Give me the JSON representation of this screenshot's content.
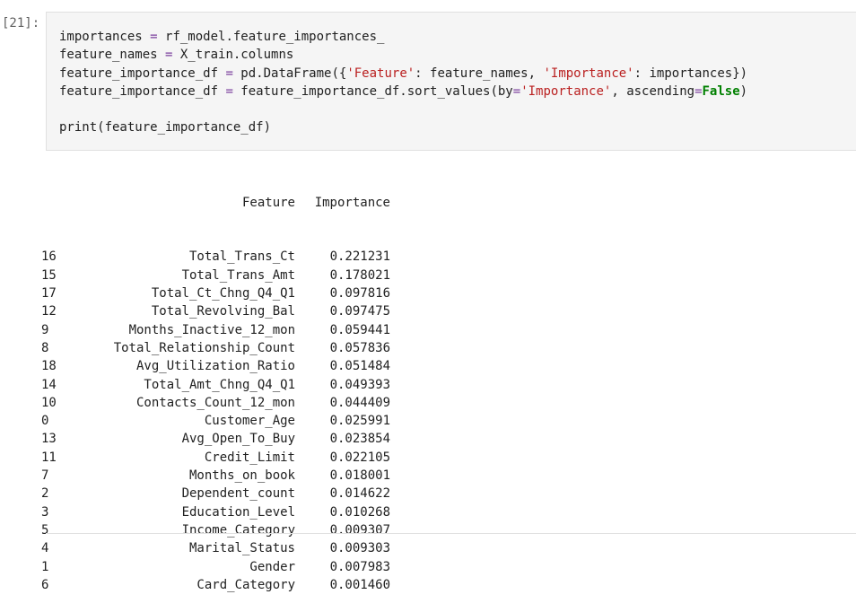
{
  "cell": {
    "prompt": "[21]:",
    "code_lines": [
      "importances = rf_model.feature_importances_",
      "feature_names = X_train.columns",
      "feature_importance_df = pd.DataFrame({'Feature': feature_names, 'Importance': importances})",
      "feature_importance_df = feature_importance_df.sort_values(by='Importance', ascending=False)",
      "",
      "print(feature_importance_df)"
    ]
  },
  "output": {
    "headers": [
      "Feature",
      "Importance"
    ],
    "rows": [
      {
        "index": "16",
        "feature": "Total_Trans_Ct",
        "importance": "0.221231"
      },
      {
        "index": "15",
        "feature": "Total_Trans_Amt",
        "importance": "0.178021"
      },
      {
        "index": "17",
        "feature": "Total_Ct_Chng_Q4_Q1",
        "importance": "0.097816"
      },
      {
        "index": "12",
        "feature": "Total_Revolving_Bal",
        "importance": "0.097475"
      },
      {
        "index": "9",
        "feature": "Months_Inactive_12_mon",
        "importance": "0.059441"
      },
      {
        "index": "8",
        "feature": "Total_Relationship_Count",
        "importance": "0.057836"
      },
      {
        "index": "18",
        "feature": "Avg_Utilization_Ratio",
        "importance": "0.051484"
      },
      {
        "index": "14",
        "feature": "Total_Amt_Chng_Q4_Q1",
        "importance": "0.049393"
      },
      {
        "index": "10",
        "feature": "Contacts_Count_12_mon",
        "importance": "0.044409"
      },
      {
        "index": "0",
        "feature": "Customer_Age",
        "importance": "0.025991"
      },
      {
        "index": "13",
        "feature": "Avg_Open_To_Buy",
        "importance": "0.023854"
      },
      {
        "index": "11",
        "feature": "Credit_Limit",
        "importance": "0.022105"
      },
      {
        "index": "7",
        "feature": "Months_on_book",
        "importance": "0.018001"
      },
      {
        "index": "2",
        "feature": "Dependent_count",
        "importance": "0.014622"
      },
      {
        "index": "3",
        "feature": "Education_Level",
        "importance": "0.010268"
      },
      {
        "index": "5",
        "feature": "Income_Category",
        "importance": "0.009307"
      },
      {
        "index": "4",
        "feature": "Marital_Status",
        "importance": "0.009303"
      },
      {
        "index": "1",
        "feature": "Gender",
        "importance": "0.007983"
      },
      {
        "index": "6",
        "feature": "Card_Category",
        "importance": "0.001460"
      }
    ]
  },
  "colors": {
    "operator": "#7a3e9d",
    "string": "#ba2121",
    "keyword": "#008000",
    "cell_background": "#f5f5f5",
    "prompt": "#616161"
  }
}
